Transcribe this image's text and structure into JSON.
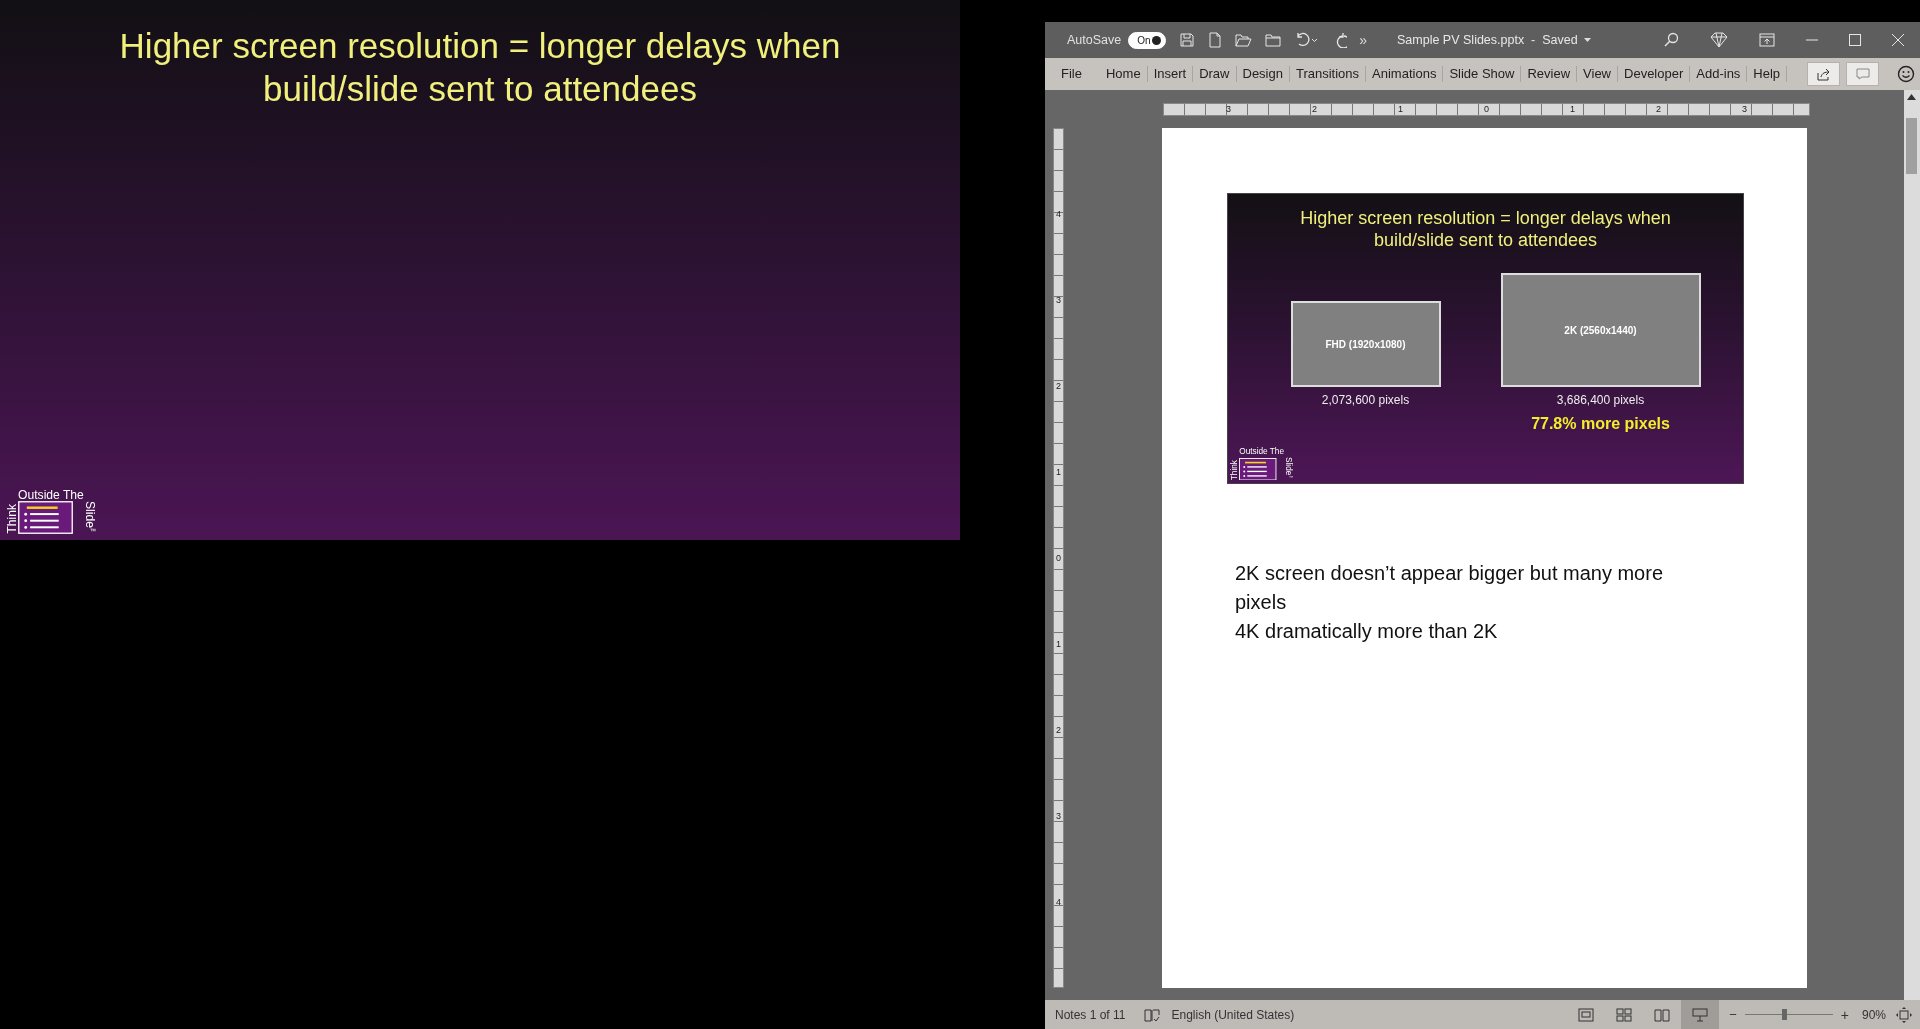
{
  "slideshow": {
    "title_lines": [
      "Higher screen resolution = longer delays when",
      "build/slide sent to attendees"
    ],
    "logo": {
      "top": "Outside The",
      "left": "Think",
      "right": "Slide",
      "mark": "™"
    }
  },
  "window": {
    "autosave": {
      "label": "AutoSave",
      "toggle_label": "On",
      "on": true
    },
    "more": "»",
    "title": "Sample PV Slides.pptx  -  Saved",
    "ribbon_tabs": [
      "File",
      "Home",
      "Insert",
      "Draw",
      "Design",
      "Transitions",
      "Animations",
      "Slide Show",
      "Review",
      "View",
      "Developer",
      "Add-ins",
      "Help"
    ]
  },
  "rulers": {
    "horizontal": [
      "3",
      "2",
      "1",
      "0",
      "1",
      "2",
      "3"
    ],
    "vertical": [
      "4",
      "3",
      "2",
      "1",
      "0",
      "1",
      "2",
      "3",
      "4"
    ]
  },
  "notes_page": {
    "slide": {
      "title_lines": [
        "Higher screen resolution = longer delays when",
        "build/slide sent to attendees"
      ],
      "screens": [
        {
          "label": "FHD (1920x1080)",
          "caption": "2,073,600 pixels",
          "kind": "small"
        },
        {
          "label": "2K (2560x1440)",
          "caption": "3,686,400 pixels",
          "kind": "large"
        }
      ],
      "highlight": "77.8% more pixels",
      "logo": {
        "top": "Outside The",
        "left": "Think",
        "right": "Slide",
        "mark": "™"
      }
    },
    "notes": [
      "2K screen doesn’t appear bigger but many more pixels",
      "4K dramatically more than 2K"
    ]
  },
  "status_bar": {
    "page_count": "Notes 1 of 11",
    "language": "English (United States)",
    "views": [
      {
        "kind": "normal",
        "selected": false
      },
      {
        "kind": "sorter",
        "selected": false
      },
      {
        "kind": "reading",
        "selected": false
      },
      {
        "kind": "notes",
        "selected": true
      }
    ],
    "zoom": {
      "minus": "−",
      "plus": "+",
      "level": 0.45,
      "reading": "90%"
    }
  }
}
